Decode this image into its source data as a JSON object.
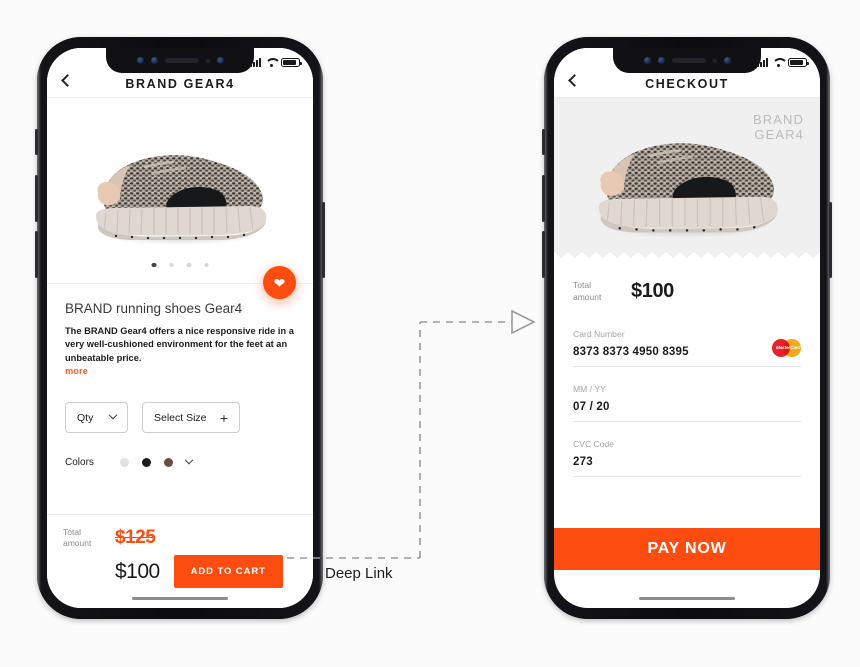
{
  "left_phone": {
    "status_bar": {
      "signal_icon": "signal-bars-icon",
      "wifi_icon": "wifi-icon",
      "battery_icon": "battery-icon"
    },
    "navbar": {
      "back_icon": "chevron-left-icon",
      "title": "BRAND  GEAR4"
    },
    "gallery": {
      "dots_total": 4,
      "active_dot": 1,
      "favorite_icon": "heart-icon",
      "product_image": "running-shoe-photo"
    },
    "product": {
      "title": "BRAND running shoes Gear4",
      "description": "The BRAND Gear4 offers a nice responsive ride in a very well-cushioned environment for the feet at an unbeatable price.",
      "more_label": "more"
    },
    "selectors": {
      "qty_label": "Qty",
      "qty_icon": "chevron-down-icon",
      "size_label": "Select Size",
      "size_icon": "plus-icon"
    },
    "colors": {
      "label": "Colors",
      "swatches": [
        "#e2e2e2",
        "#1d1d1d",
        "#6e4c3f"
      ],
      "expand_icon": "chevron-down-icon"
    },
    "buy_bar": {
      "total_label_line1": "Total",
      "total_label_line2": "amount",
      "old_price": "$125",
      "new_price": "$100",
      "cart_button": "ADD TO CART"
    }
  },
  "right_phone": {
    "status_bar": {
      "signal_icon": "signal-bars-icon",
      "wifi_icon": "wifi-icon",
      "battery_icon": "battery-icon"
    },
    "navbar": {
      "back_icon": "chevron-left-icon",
      "title": "CHECKOUT"
    },
    "hero": {
      "brand_line1": "BRAND",
      "brand_line2": "GEAR4",
      "product_image": "running-shoe-photo"
    },
    "summary": {
      "total_label_line1": "Total",
      "total_label_line2": "amount",
      "total_value": "$100"
    },
    "form": {
      "card_number": {
        "label": "Card Number",
        "value": "8373 8373 4950 8395",
        "brand_icon": "mastercard-icon"
      },
      "expiry": {
        "label": "MM / YY",
        "value": "07 / 20"
      },
      "cvc": {
        "label": "CVC Code",
        "value": "273"
      }
    },
    "pay_button": "PAY NOW"
  },
  "connector": {
    "label": "Deep Link",
    "arrow_icon": "arrow-right-outline-icon",
    "line_color": "#9a9a9a"
  },
  "theme": {
    "accent": "#fc4c10",
    "text": "#1c1c1c",
    "muted": "#8b8b8b",
    "bg": "#fbfbfb"
  }
}
